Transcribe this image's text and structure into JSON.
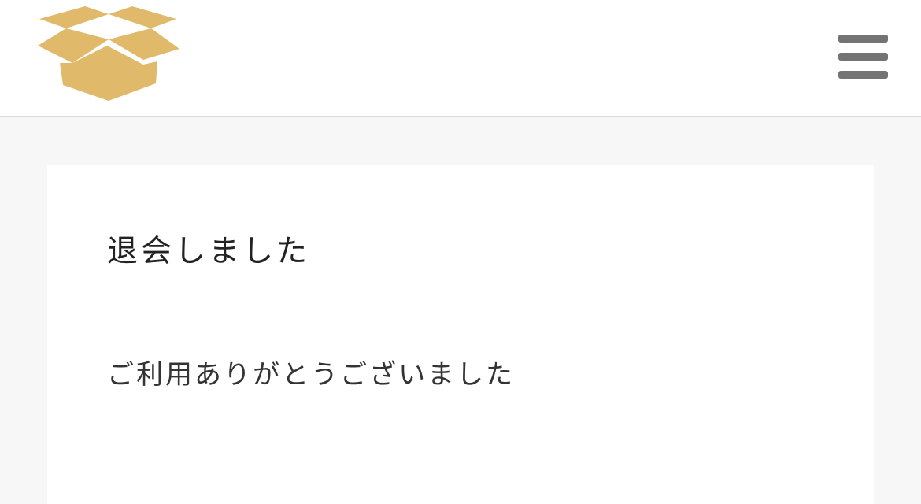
{
  "header": {
    "logo_icon": "open-box-icon",
    "logo_color": "#e0b96a",
    "menu_icon": "hamburger-menu-icon",
    "menu_color": "#747474"
  },
  "main": {
    "title": "退会しました",
    "message": "ご利用ありがとうございました"
  }
}
